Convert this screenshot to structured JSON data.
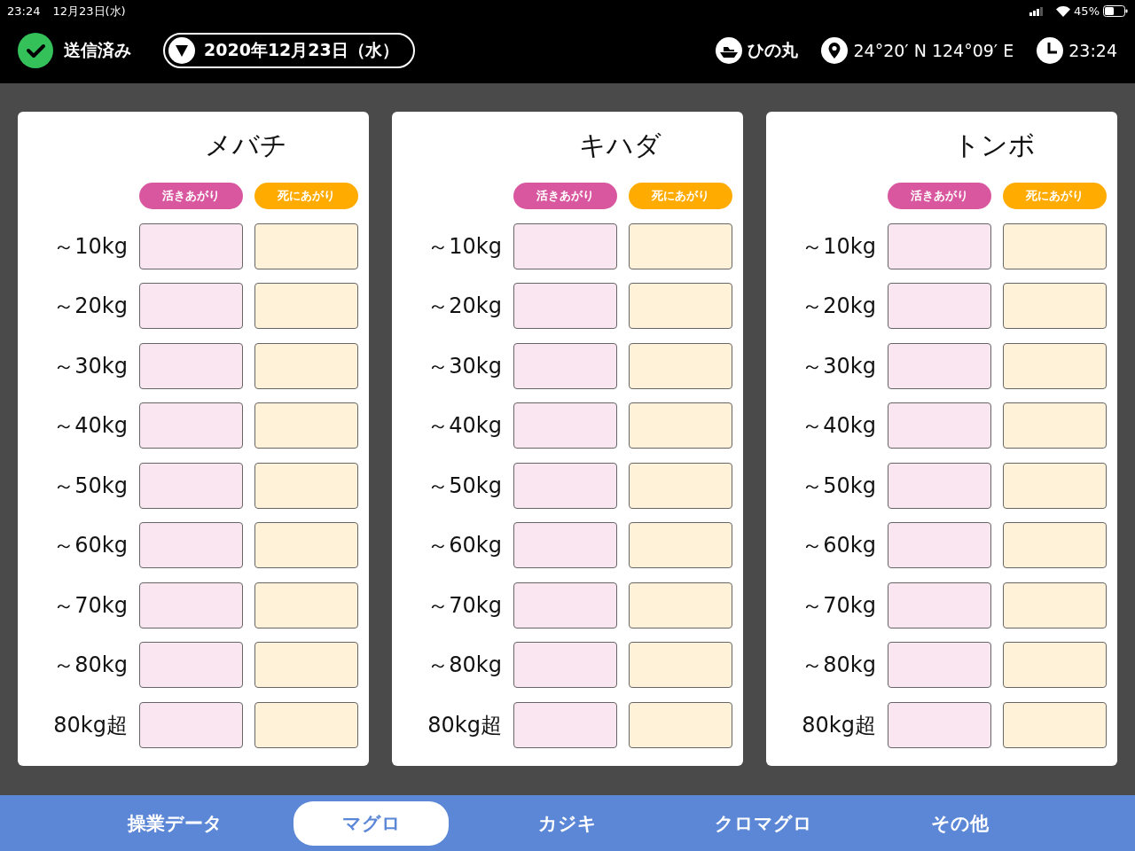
{
  "status_bar": {
    "time": "23:24",
    "date": "12月23日(水)",
    "battery": "45%"
  },
  "header": {
    "sent_status": "送信済み",
    "date": "2020年12月23日（水）",
    "vessel": "ひの丸",
    "position": "24°20′ N 124°09′ E",
    "time": "23:24"
  },
  "species": [
    {
      "name": "メバチ",
      "columns": [
        {
          "label": "活きあがり",
          "color": "#d9579f"
        },
        {
          "label": "死にあがり",
          "color": "#ffab00"
        }
      ],
      "rows": [
        "～10kg",
        "～20kg",
        "～30kg",
        "～40kg",
        "～50kg",
        "～60kg",
        "～70kg",
        "～80kg",
        "80kg超"
      ]
    },
    {
      "name": "キハダ",
      "columns": [
        {
          "label": "活きあがり",
          "color": "#d9579f"
        },
        {
          "label": "死にあがり",
          "color": "#ffab00"
        }
      ],
      "rows": [
        "～10kg",
        "～20kg",
        "～30kg",
        "～40kg",
        "～50kg",
        "～60kg",
        "～70kg",
        "～80kg",
        "80kg超"
      ]
    },
    {
      "name": "トンボ",
      "columns": [
        {
          "label": "活きあがり",
          "color": "#d9579f"
        },
        {
          "label": "死にあがり",
          "color": "#ffab00"
        }
      ],
      "rows": [
        "～10kg",
        "～20kg",
        "～30kg",
        "～40kg",
        "～50kg",
        "～60kg",
        "～70kg",
        "～80kg",
        "80kg超"
      ]
    }
  ],
  "tabs": [
    {
      "label": "操業データ",
      "selected": false
    },
    {
      "label": "マグロ",
      "selected": true
    },
    {
      "label": "カジキ",
      "selected": false
    },
    {
      "label": "クロマグロ",
      "selected": false
    },
    {
      "label": "その他",
      "selected": false
    }
  ]
}
